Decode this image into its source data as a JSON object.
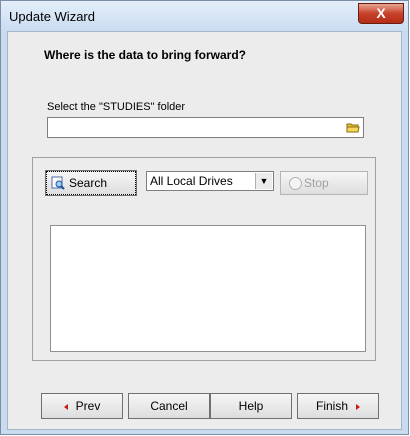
{
  "window": {
    "title": "Update Wizard",
    "close_label": "X"
  },
  "page": {
    "heading": "Where is the data to bring forward?",
    "folder_label": "Select the \"STUDIES\" folder",
    "folder_path": ""
  },
  "search": {
    "search_label": "Search",
    "drives_selected": "All Local Drives",
    "stop_label": "Stop"
  },
  "footer": {
    "prev_label": "Prev",
    "cancel_label": "Cancel",
    "help_label": "Help",
    "finish_label": "Finish"
  },
  "colors": {
    "accent_arrow": "#c01e1e",
    "close_button": "#c6412a",
    "folder_icon": "#e8c13a"
  }
}
